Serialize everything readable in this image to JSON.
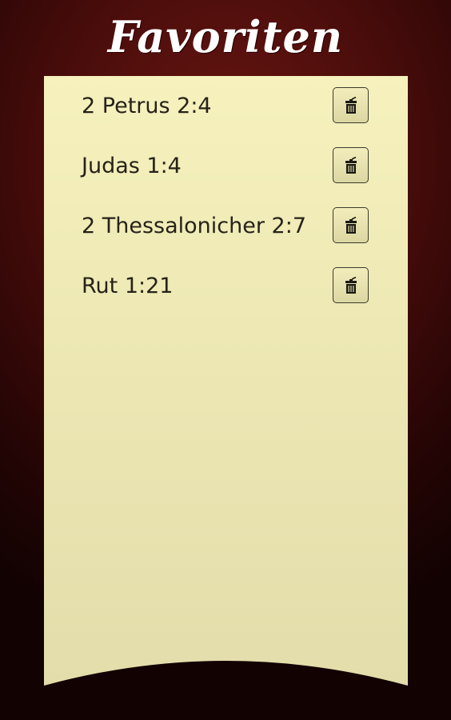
{
  "header": {
    "title": "Favoriten"
  },
  "favorites": [
    {
      "label": "2 Petrus 2:4",
      "delete_icon": "trash-icon"
    },
    {
      "label": "Judas 1:4",
      "delete_icon": "trash-icon"
    },
    {
      "label": "2 Thessalonicher 2:7",
      "delete_icon": "trash-icon"
    },
    {
      "label": "Rut 1:21",
      "delete_icon": "trash-icon"
    }
  ],
  "colors": {
    "background_center": "#6a1612",
    "background_edge": "#120202",
    "panel": "#f6f1bd",
    "text": "#262218"
  }
}
